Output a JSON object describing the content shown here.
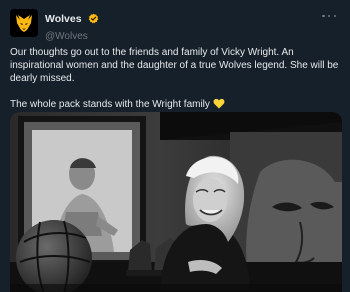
{
  "account": {
    "display_name": "Wolves",
    "handle": "@Wolves",
    "verified": true,
    "brand_color": "#fdb913",
    "avatar_icon": "wolves-wolf-head-logo"
  },
  "tweet": {
    "paragraph_1": "Our thoughts go out to the friends and family of Vicky Wright. An inspirational women and the daughter of a true Wolves legend. She will be dearly missed.",
    "paragraph_2": "The whole pack stands with the Wright family",
    "emoji": "yellow-heart-icon"
  },
  "media": {
    "type": "photo",
    "style": "black-and-white"
  },
  "colors": {
    "background": "#15202b",
    "text": "#e7e9ea",
    "secondary_text": "#71767b",
    "verified_badge": "#fdb913",
    "heart": "#ffd43b"
  }
}
